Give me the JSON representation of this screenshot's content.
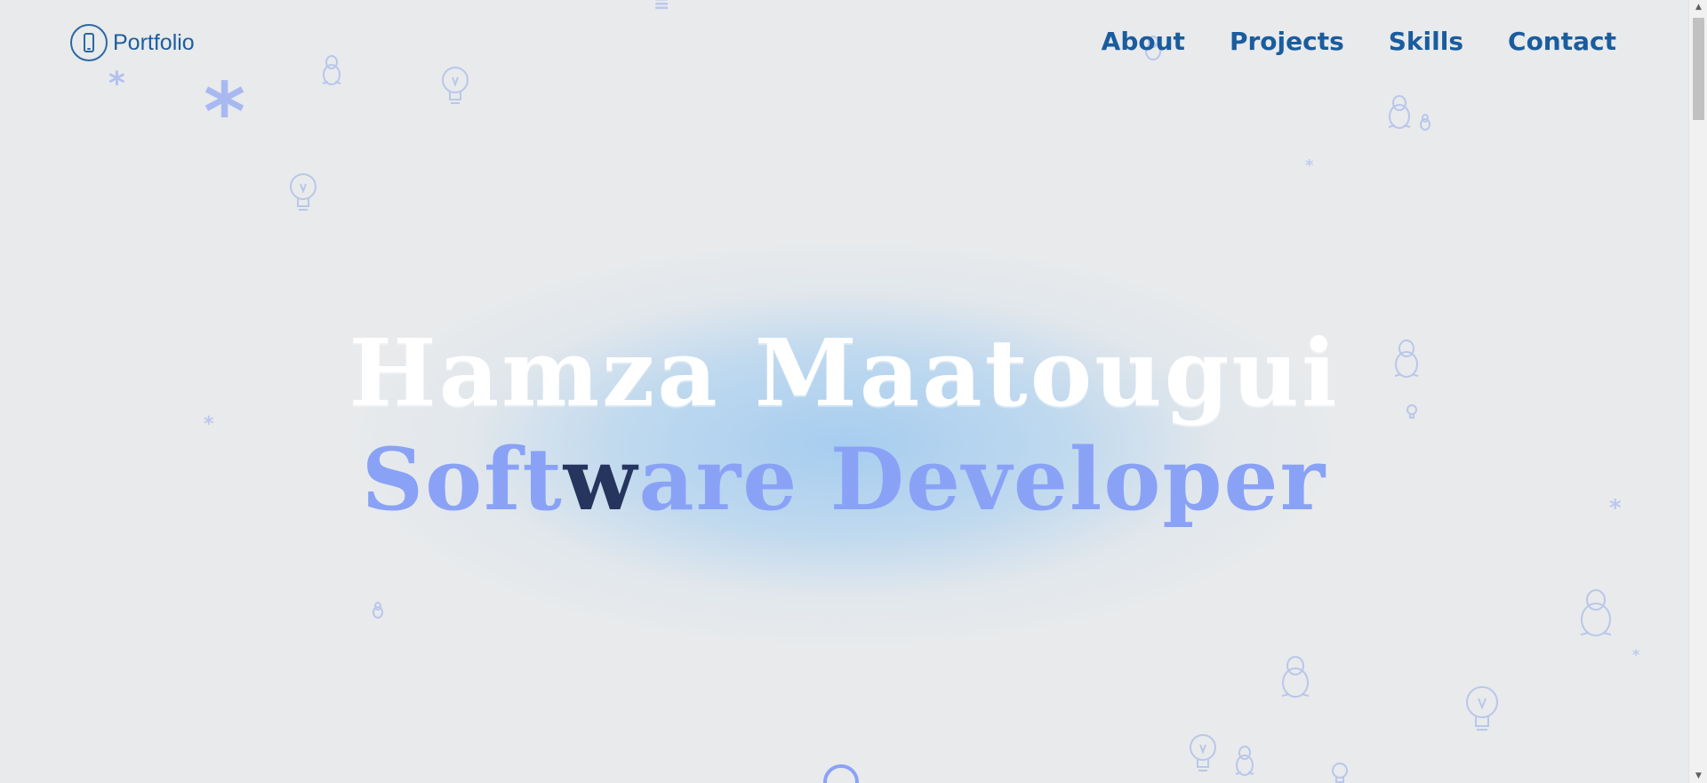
{
  "header": {
    "logo_text": "Portfolio",
    "logo_icon": "smartphone-icon"
  },
  "nav": {
    "items": [
      "About",
      "Projects",
      "Skills",
      "Contact"
    ]
  },
  "hero": {
    "name": "Hamza Maatougui",
    "role_before": "Soft",
    "role_highlight": "w",
    "role_after": "are Developer"
  },
  "colors": {
    "background": "#e8eaec",
    "nav_text": "#1a5c9e",
    "hero_name": "#ffffff",
    "hero_role": "#8aa2f6",
    "hero_role_highlight": "#25355e",
    "glow": "#a9d0f0"
  },
  "decorations": [
    "lightbulb-icon",
    "penguin-icon",
    "asterisk-icon"
  ]
}
